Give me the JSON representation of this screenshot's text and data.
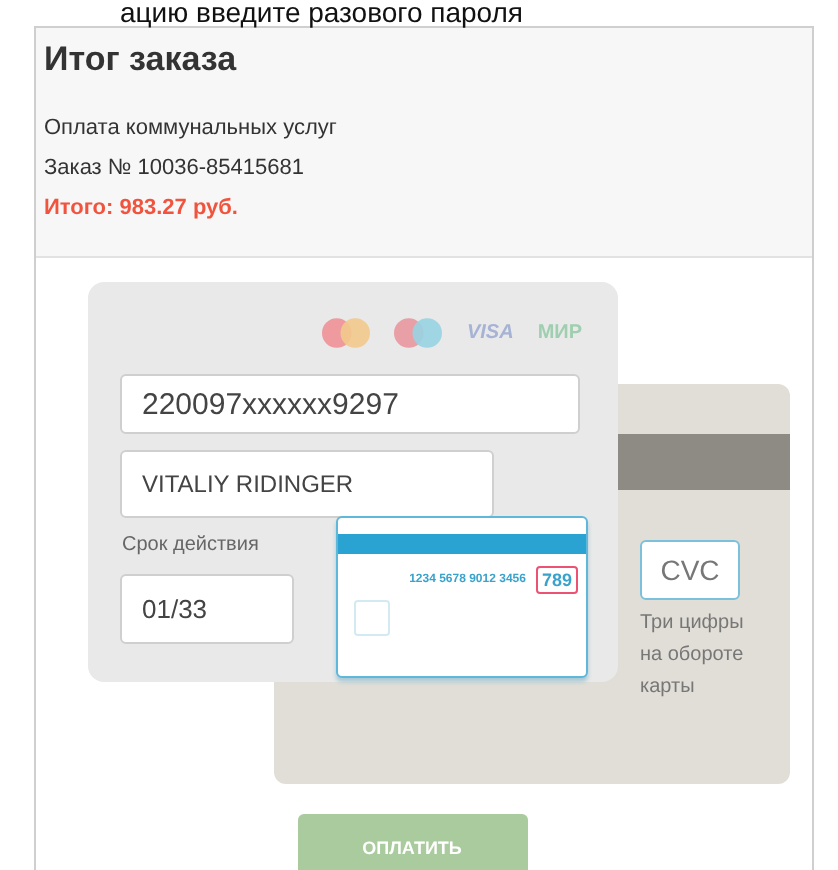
{
  "top_cut_text": "ацию введите разового пароля",
  "order": {
    "title": "Итог заказа",
    "description": "Оплата коммунальных услуг",
    "number": "Заказ № 10036-85415681",
    "total": "Итого: 983.27 руб."
  },
  "card_front": {
    "brands": [
      "VISA",
      "МИР"
    ],
    "card_number": "220097xxxxxx9297",
    "holder": "VITALIY RIDINGER",
    "expiry_label": "Срок действия",
    "expiry": "01/33"
  },
  "card_hint": {
    "number": "1234 5678 9012 3456",
    "cvc": "789"
  },
  "card_back": {
    "cvc_placeholder": "CVC",
    "cvc_hint": "Три цифры на обороте карты"
  },
  "pay_button": {
    "label": "ОПЛАТИТЬ",
    "disabled": true
  }
}
